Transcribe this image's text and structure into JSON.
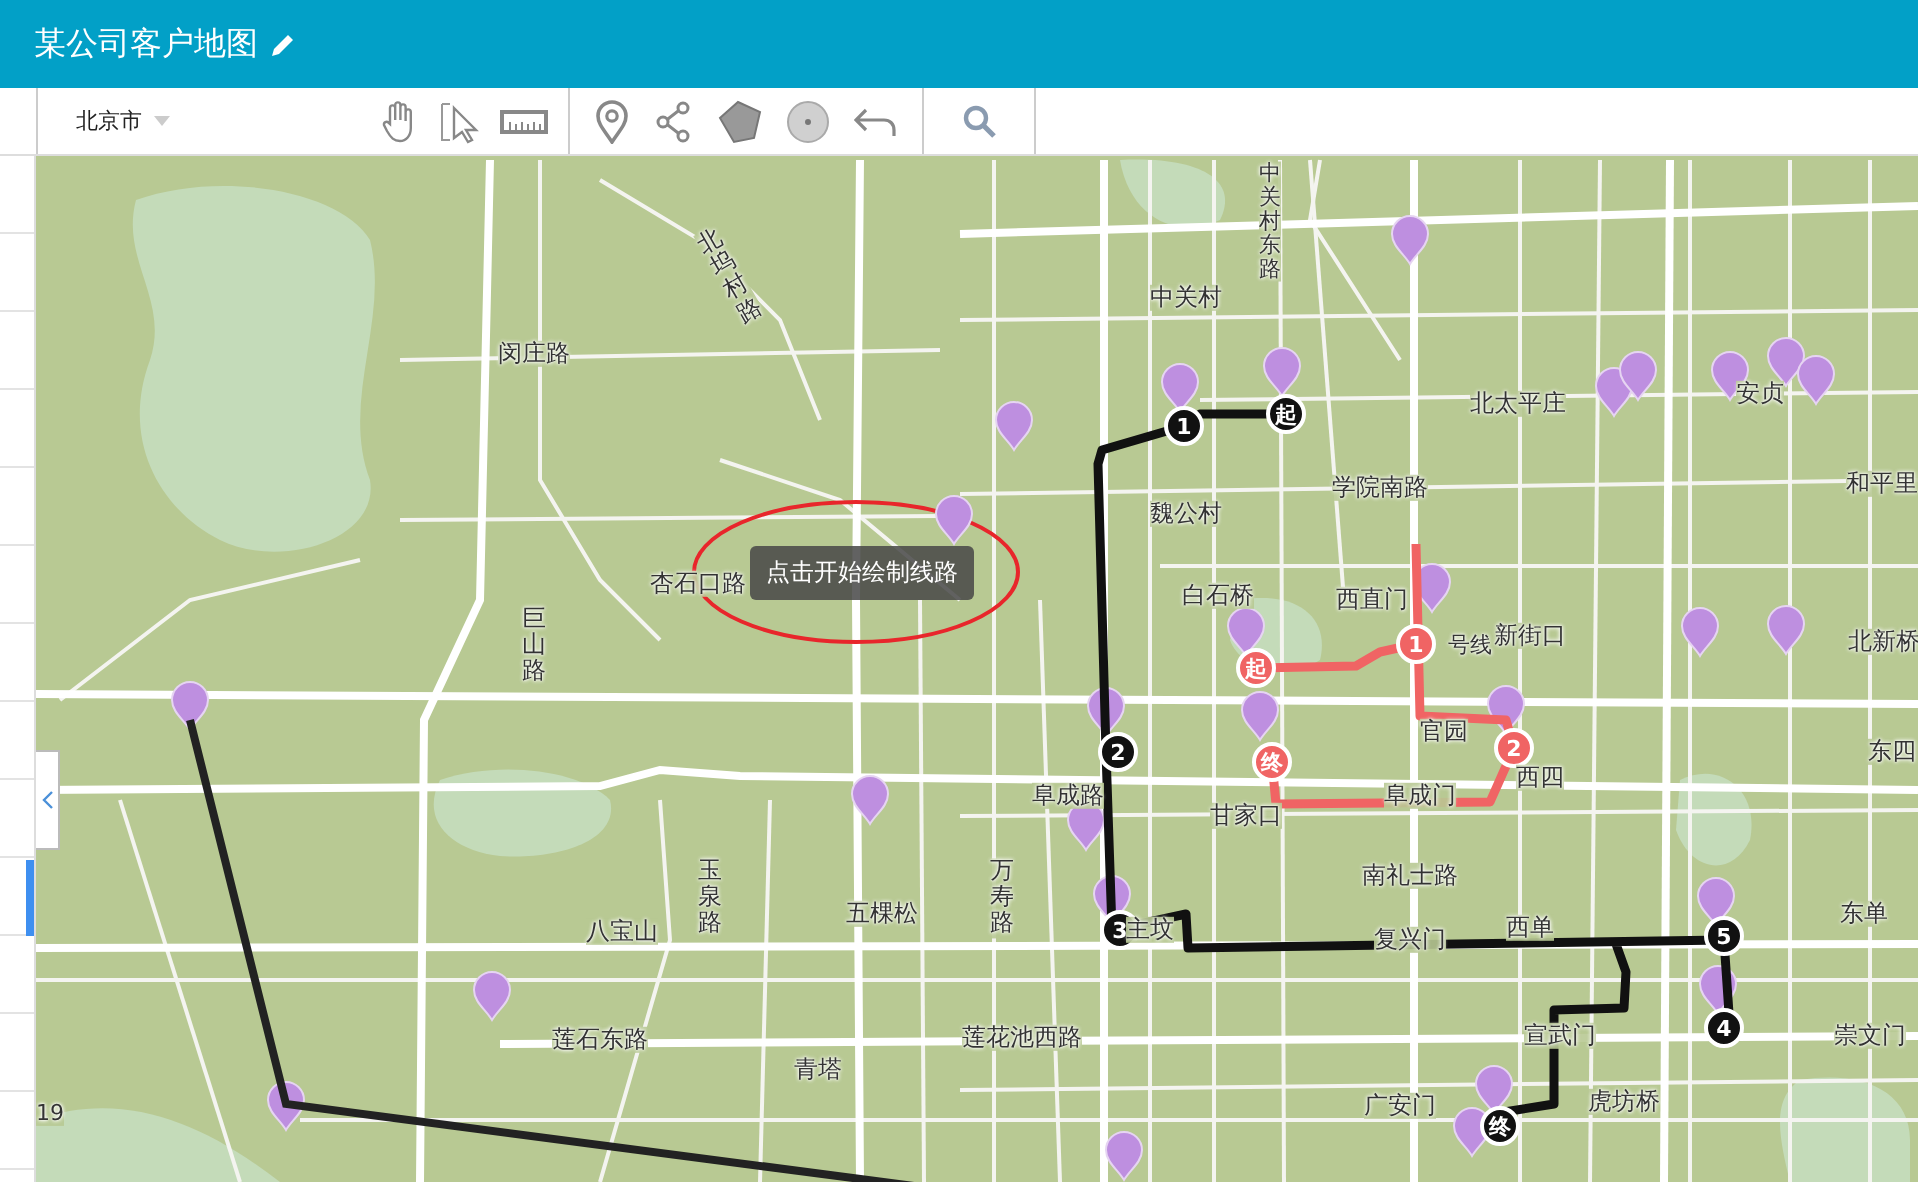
{
  "header": {
    "title": "某公司客户地图"
  },
  "toolbar": {
    "city": "北京市"
  },
  "map": {
    "labels": [
      "北坞村路",
      "闵庄路",
      "杏石口路",
      "巨山路",
      "中关村东路",
      "中关村",
      "北太平庄",
      "安贞",
      "学院南路",
      "和平里",
      "魏公村",
      "白石桥",
      "西直门",
      "号线",
      "新街口",
      "北新桥",
      "官园",
      "西四",
      "东四",
      "阜成门",
      "甘家口",
      "阜成路",
      "万寿路",
      "南礼士路",
      "主坟",
      "复兴门",
      "西单",
      "东单",
      "八宝山",
      "玉泉路",
      "五棵松",
      "莲石东路",
      "莲花池西路",
      "青塔",
      "宣武门",
      "崇文门",
      "19",
      "广安门",
      "虎坊桥"
    ],
    "tooltip": "点击开始绘制线路",
    "routes": [
      {
        "color": "#111111",
        "stops": [
          "起",
          "1",
          "2",
          "3",
          "5",
          "4",
          "终"
        ]
      },
      {
        "color": "#f06464",
        "stops": [
          "起",
          "1",
          "2",
          "终"
        ]
      }
    ]
  }
}
